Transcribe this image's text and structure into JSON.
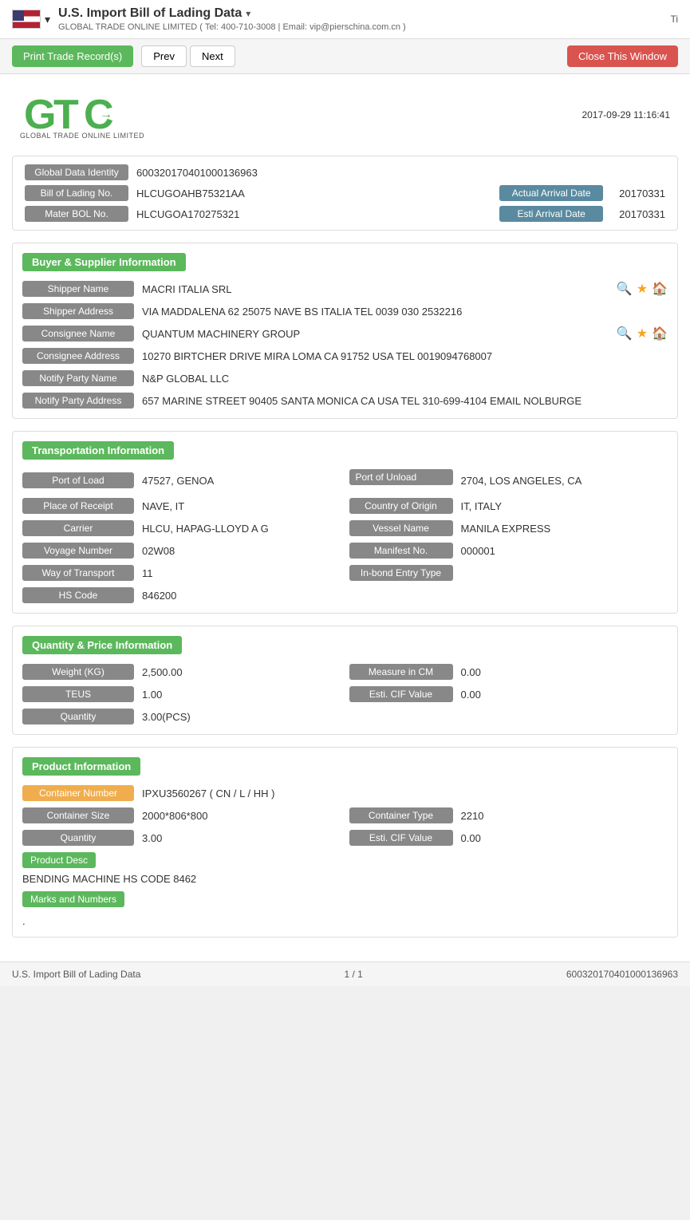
{
  "header": {
    "title": "U.S. Import Bill of Lading Data",
    "subtitle": "GLOBAL TRADE ONLINE LIMITED ( Tel: 400-710-3008 | Email: vip@pierschina.com.cn )",
    "right_label": "Ti"
  },
  "toolbar": {
    "print_label": "Print Trade Record(s)",
    "prev_label": "Prev",
    "next_label": "Next",
    "close_label": "Close This Window"
  },
  "logo": {
    "datetime": "2017-09-29 11:16:41",
    "sub_text": "GLOBAL TRADE ONLINE LIMITED"
  },
  "identity": {
    "global_data_identity_label": "Global Data Identity",
    "global_data_identity_value": "600320170401000136963",
    "bill_of_lading_no_label": "Bill of Lading No.",
    "bill_of_lading_no_value": "HLCUGOAHB75321AA",
    "actual_arrival_date_label": "Actual Arrival Date",
    "actual_arrival_date_value": "20170331",
    "mater_bol_no_label": "Mater BOL No.",
    "mater_bol_no_value": "HLCUGOA170275321",
    "esti_arrival_date_label": "Esti Arrival Date",
    "esti_arrival_date_value": "20170331"
  },
  "buyer_supplier": {
    "section_label": "Buyer & Supplier Information",
    "shipper_name_label": "Shipper Name",
    "shipper_name_value": "MACRI ITALIA SRL",
    "shipper_address_label": "Shipper Address",
    "shipper_address_value": "VIA MADDALENA 62 25075 NAVE BS ITALIA TEL 0039 030 2532216",
    "consignee_name_label": "Consignee Name",
    "consignee_name_value": "QUANTUM MACHINERY GROUP",
    "consignee_address_label": "Consignee Address",
    "consignee_address_value": "10270 BIRTCHER DRIVE MIRA LOMA CA 91752 USA TEL 0019094768007",
    "notify_party_name_label": "Notify Party Name",
    "notify_party_name_value": "N&P GLOBAL LLC",
    "notify_party_address_label": "Notify Party Address",
    "notify_party_address_value": "657 MARINE STREET 90405 SANTA MONICA CA USA TEL 310-699-4104 EMAIL NOLBURGE"
  },
  "transportation": {
    "section_label": "Transportation Information",
    "port_of_load_label": "Port of Load",
    "port_of_load_value": "47527, GENOA",
    "port_of_unload_label": "Port of Unload",
    "port_of_unload_value": "2704, LOS ANGELES, CA",
    "place_of_receipt_label": "Place of Receipt",
    "place_of_receipt_value": "NAVE, IT",
    "country_of_origin_label": "Country of Origin",
    "country_of_origin_value": "IT, ITALY",
    "carrier_label": "Carrier",
    "carrier_value": "HLCU, HAPAG-LLOYD A G",
    "vessel_name_label": "Vessel Name",
    "vessel_name_value": "MANILA EXPRESS",
    "voyage_number_label": "Voyage Number",
    "voyage_number_value": "02W08",
    "manifest_no_label": "Manifest No.",
    "manifest_no_value": "000001",
    "way_of_transport_label": "Way of Transport",
    "way_of_transport_value": "11",
    "in_bond_entry_type_label": "In-bond Entry Type",
    "in_bond_entry_type_value": "",
    "hs_code_label": "HS Code",
    "hs_code_value": "846200"
  },
  "quantity_price": {
    "section_label": "Quantity & Price Information",
    "weight_kg_label": "Weight (KG)",
    "weight_kg_value": "2,500.00",
    "measure_in_cm_label": "Measure in CM",
    "measure_in_cm_value": "0.00",
    "teus_label": "TEUS",
    "teus_value": "1.00",
    "esti_cif_value_label": "Esti. CIF Value",
    "esti_cif_value_value": "0.00",
    "quantity_label": "Quantity",
    "quantity_value": "3.00(PCS)"
  },
  "product_information": {
    "section_label": "Product Information",
    "container_number_label": "Container Number",
    "container_number_value": "IPXU3560267 ( CN / L / HH )",
    "container_size_label": "Container Size",
    "container_size_value": "2000*806*800",
    "container_type_label": "Container Type",
    "container_type_value": "2210",
    "quantity_label": "Quantity",
    "quantity_value": "3.00",
    "esti_cif_value_label": "Esti. CIF Value",
    "esti_cif_value_value": "0.00",
    "product_desc_btn": "Product Desc",
    "product_desc_text": "BENDING MACHINE HS CODE 8462",
    "marks_and_numbers_btn": "Marks and Numbers",
    "marks_and_numbers_value": "."
  },
  "bottom_bar": {
    "left": "U.S. Import Bill of Lading Data",
    "center": "1 / 1",
    "right": "600320170401000136963"
  }
}
